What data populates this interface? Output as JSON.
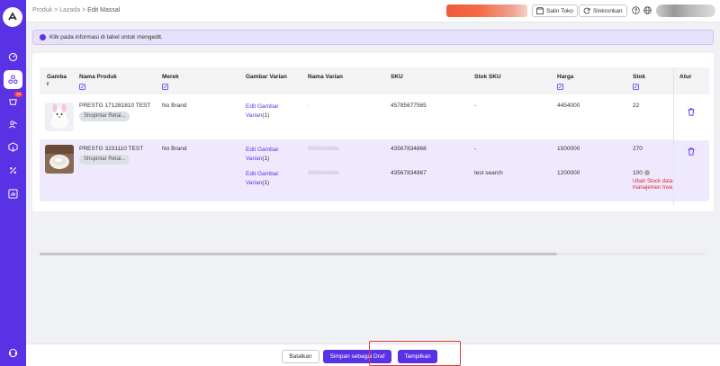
{
  "breadcrumb": {
    "items": [
      "Produk",
      "Lazada"
    ],
    "separator": ">",
    "current": "Edit Massal"
  },
  "header": {
    "copy_store": "Salin Toko",
    "sync": "Sinkronkan"
  },
  "sidebar": {
    "order_badge": "10"
  },
  "info": {
    "text": "Klik pada informasi di tabel untuk mengedit."
  },
  "table": {
    "headers": {
      "image": "Gamba r",
      "product_name": "Nama Produk",
      "brand": "Merek",
      "variant_image": "Gambar Varian",
      "variant_name": "Nama Varian",
      "sku": "SKU",
      "sku_stock": "Stok SKU",
      "price": "Harga",
      "stock": "Stok",
      "action": "Atur"
    },
    "rows": [
      {
        "name": "PRESTG 171281810 TEST",
        "store_tag": "Shopintar Retai...",
        "brand": "No Brand",
        "variants": [
          {
            "image_link": "Edit Gambar",
            "image_link2": "Varian",
            "count": "(1)",
            "name": "-",
            "sku": "45785677565",
            "sku_stock": "-",
            "price": "4454000",
            "stock": "22"
          }
        ]
      },
      {
        "name": "PRESTG 3231110 TEST",
        "store_tag": "Shopintar Retai...",
        "brand": "No Brand",
        "variants": [
          {
            "image_link": "Edit Gambar",
            "image_link2": "Varian",
            "count": "(1)",
            "name": "500ml/white",
            "sku": "43567834868",
            "sku_stock": "-",
            "price": "1500000",
            "stock": "270"
          },
          {
            "image_link": "Edit Gambar",
            "image_link2": "Varian",
            "count": "(1)",
            "name": "300ml/white",
            "sku": "43567834867",
            "sku_stock": "test search",
            "price": "1200000",
            "stock": "100",
            "warning1": "Ubah Stock data",
            "warning2": "manajemen Inve"
          }
        ]
      }
    ]
  },
  "footer": {
    "cancel": "Batalkan",
    "save_draft": "Simpan sebagai Draf",
    "publish": "Tampilkan"
  },
  "colors": {
    "brand": "#5a32e6",
    "info_bg": "#e6e0fa",
    "selected_row": "#efe9fd",
    "warning": "#e0263a",
    "highlight": "#e53935"
  },
  "icons": [
    "logo-icon",
    "dashboard-icon",
    "products-icon",
    "orders-icon",
    "customers-icon",
    "inventory-icon",
    "promotions-icon",
    "reports-icon",
    "support-icon",
    "store-icon",
    "sync-icon",
    "help-icon",
    "globe-icon",
    "edit-icon",
    "trash-icon",
    "info-icon"
  ]
}
